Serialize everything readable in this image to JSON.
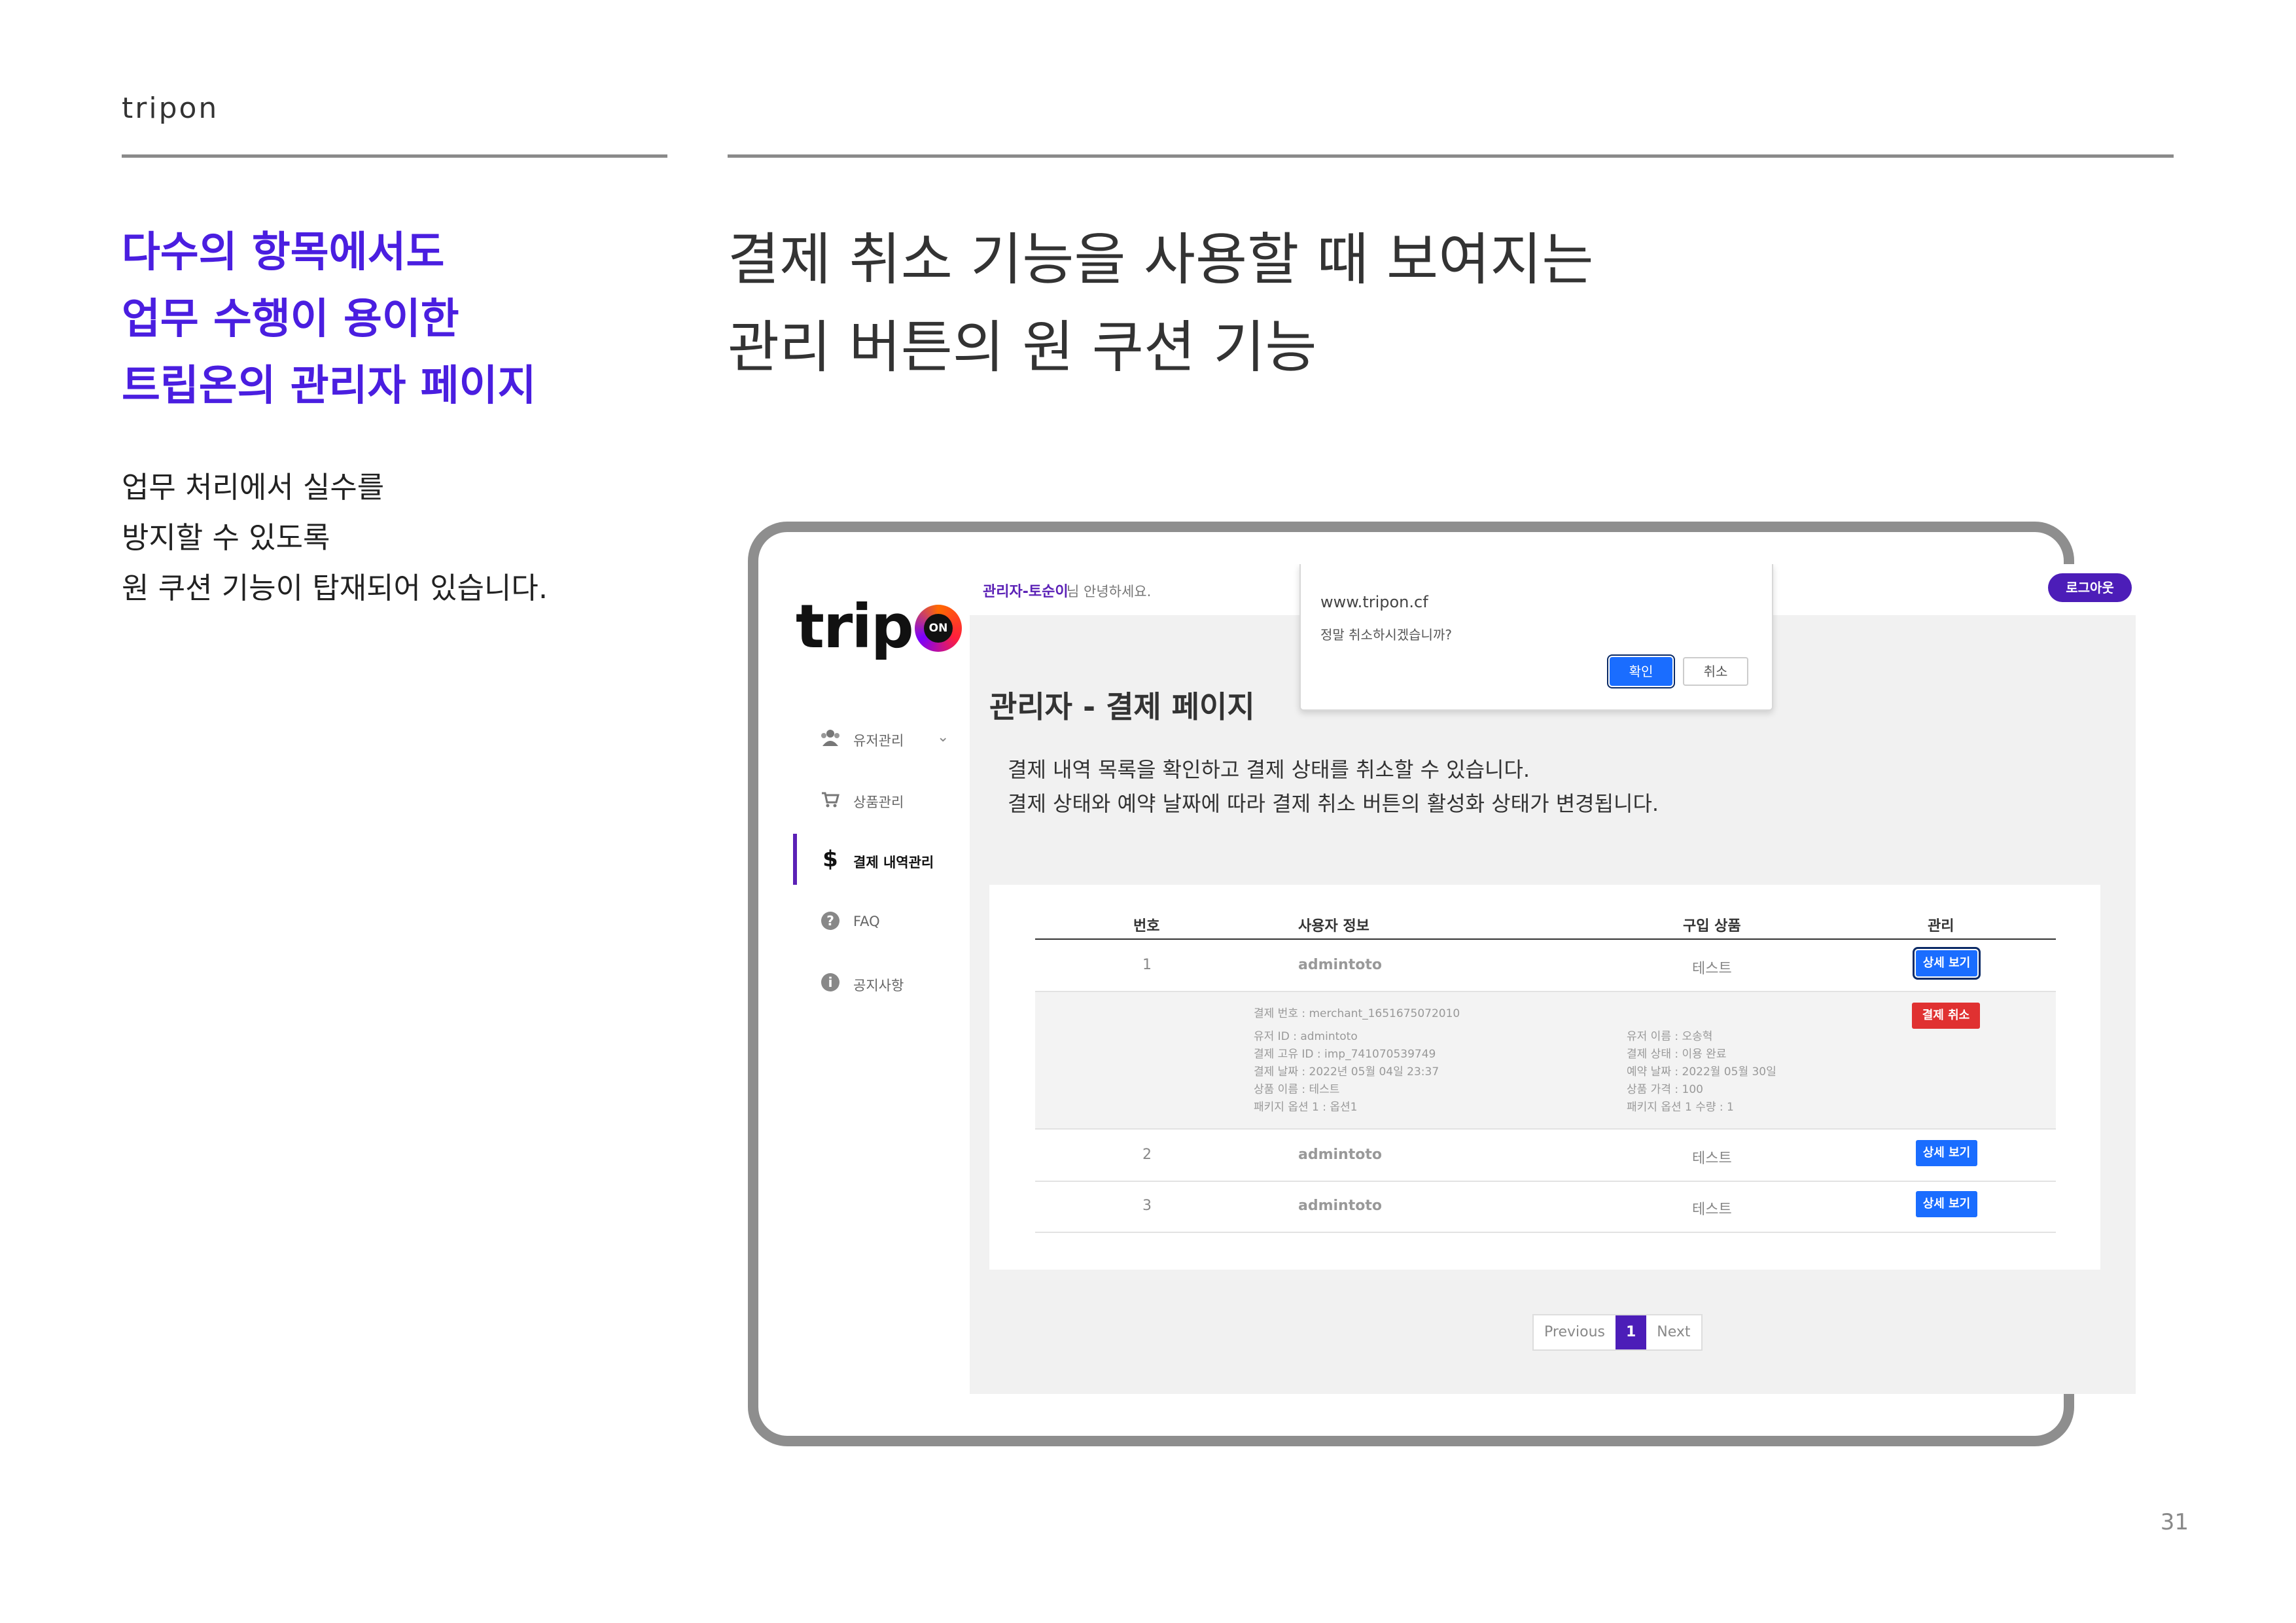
{
  "slide": {
    "brand": "tripon",
    "headline_purple": [
      "다수의 항목에서도",
      "업무 수행이 용이한",
      "트립온의 관리자 페이지"
    ],
    "description": [
      "업무 처리에서 실수를",
      "방지할 수 있도록",
      "원 쿠션 기능이 탑재되어 있습니다."
    ],
    "title": [
      "결제 취소 기능을 사용할 때 보여지는",
      "관리 버튼의 원 쿠션 기능"
    ],
    "page_number": "31"
  },
  "app": {
    "logo_text": "trip",
    "logo_badge": "ON",
    "sidebar": [
      {
        "label": "유저관리",
        "icon": "users-icon",
        "chevron": "⌄"
      },
      {
        "label": "상품관리",
        "icon": "cart-icon"
      },
      {
        "label": "결제 내역관리",
        "icon": "dollar-icon",
        "active": true
      },
      {
        "label": "FAQ",
        "icon": "question-icon"
      },
      {
        "label": "공지사항",
        "icon": "info-icon"
      }
    ],
    "greeting_name": "관리자-토순이",
    "greeting_rest": "님 안녕하세요.",
    "logout_label": "로그아웃",
    "page_heading": "관리자 - 결제 페이지",
    "intro": [
      "결제 내역 목록을 확인하고 결제 상태를 취소할 수 있습니다.",
      "결제 상태와 예약 날짜에 따라 결제 취소 버튼의 활성화 상태가 변경됩니다."
    ],
    "table": {
      "headers": [
        "번호",
        "사용자 정보",
        "구입 상품",
        "관리"
      ],
      "rows": [
        {
          "no": "1",
          "user": "admintoto",
          "product": "테스트",
          "action": "상세 보기"
        },
        {
          "no": "2",
          "user": "admintoto",
          "product": "테스트",
          "action": "상세 보기"
        },
        {
          "no": "3",
          "user": "admintoto",
          "product": "테스트",
          "action": "상세 보기"
        }
      ],
      "detail": {
        "left": [
          "결제 번호 : merchant_1651675072010",
          "유저 ID : admintoto",
          "결제 고유 ID : imp_741070539749",
          "결제 날짜 : 2022년 05월 04일 23:37",
          "상품 이름 : 테스트",
          "패키지 옵션 1 : 옵션1"
        ],
        "right": [
          "유저 이름 : 오송혁",
          "결제 상태 : 이용 완료",
          "예약 날짜 : 2022월 05월 30일",
          "상품 가격 : 100",
          "패키지 옵션 1 수량 : 1"
        ],
        "cancel_label": "결제 취소"
      }
    },
    "pagination": {
      "previous": "Previous",
      "current": "1",
      "next": "Next"
    },
    "dialog": {
      "site": "www.tripon.cf",
      "message": "정말 취소하시겠습니까?",
      "ok": "확인",
      "cancel": "취소"
    }
  },
  "colors": {
    "accent_purple": "#4a1ee0",
    "button_blue": "#1a6dff",
    "cancel_red": "#e03131"
  }
}
